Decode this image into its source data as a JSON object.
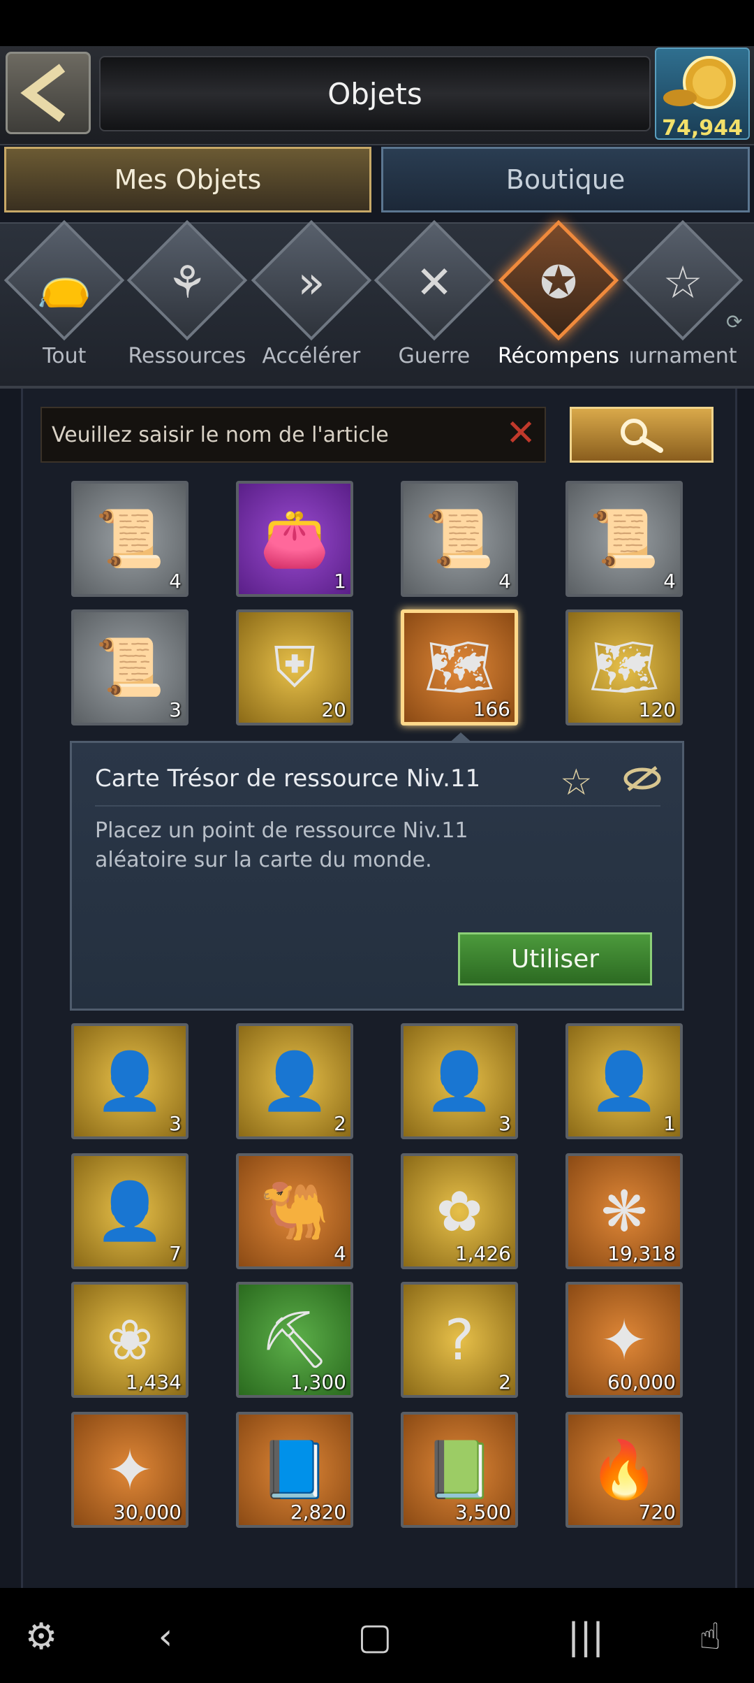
{
  "header": {
    "title": "Objets",
    "currency": "74,944"
  },
  "tabs": [
    {
      "label": "Mes Objets"
    },
    {
      "label": "Boutique"
    }
  ],
  "categories": [
    {
      "label": "Tout",
      "icon": "bag-icon"
    },
    {
      "label": "Ressources",
      "icon": "leaf-icon"
    },
    {
      "label": "Accélérer",
      "icon": "fast-forward-icon"
    },
    {
      "label": "Guerre",
      "icon": "crossed-swords-icon"
    },
    {
      "label": "Récompens",
      "icon": "star-compass-icon"
    },
    {
      "label": "ıurnament",
      "icon": "star-icon"
    }
  ],
  "search": {
    "placeholder": "Veuillez saisir le nom de l'article"
  },
  "items_top": [
    {
      "count": "4",
      "bg": "gray",
      "art": "scroll-map-icon"
    },
    {
      "count": "1",
      "bg": "purple",
      "art": "pouch-icon"
    },
    {
      "count": "4",
      "bg": "gray",
      "art": "scroll-map-icon"
    },
    {
      "count": "4",
      "bg": "gray",
      "art": "scroll-map-icon"
    },
    {
      "count": "3",
      "bg": "gray",
      "art": "scroll-map-icon"
    },
    {
      "count": "20",
      "bg": "gold",
      "art": "knight-puzzle-icon"
    },
    {
      "count": "166",
      "bg": "orange",
      "art": "treasure-map-icon"
    },
    {
      "count": "120",
      "bg": "gold",
      "art": "treasure-map-icon"
    }
  ],
  "detail": {
    "title": "Carte Trésor de ressource Niv.11",
    "description": "Placez un point de ressource Niv.11 aléatoire sur la carte du monde.",
    "use_label": "Utiliser"
  },
  "items_bottom": [
    {
      "count": "3",
      "bg": "gold",
      "art": "portrait-icon"
    },
    {
      "count": "2",
      "bg": "gold",
      "art": "portrait-icon"
    },
    {
      "count": "3",
      "bg": "gold",
      "art": "portrait-icon"
    },
    {
      "count": "1",
      "bg": "gold",
      "art": "portrait-icon"
    },
    {
      "count": "7",
      "bg": "gold",
      "art": "portrait-icon"
    },
    {
      "count": "4",
      "bg": "orange",
      "art": "camel-coin-icon"
    },
    {
      "count": "1,426",
      "bg": "gold",
      "art": "blossom-branch-icon"
    },
    {
      "count": "19,318",
      "bg": "orange",
      "art": "gold-flower-icon"
    },
    {
      "count": "1,434",
      "bg": "gold",
      "art": "lotus-icon"
    },
    {
      "count": "1,300",
      "bg": "green",
      "art": "pickaxe-icon"
    },
    {
      "count": "2",
      "bg": "gold",
      "art": "mystery-puzzle-icon"
    },
    {
      "count": "60,000",
      "bg": "orange",
      "art": "purple-puzzle-icon"
    },
    {
      "count": "30,000",
      "bg": "orange",
      "art": "green-puzzle-icon"
    },
    {
      "count": "2,820",
      "bg": "orange",
      "art": "blue-book-icon"
    },
    {
      "count": "3,500",
      "bg": "orange",
      "art": "trident-book-icon"
    },
    {
      "count": "720",
      "bg": "orange",
      "art": "fire-stone-icon"
    }
  ]
}
